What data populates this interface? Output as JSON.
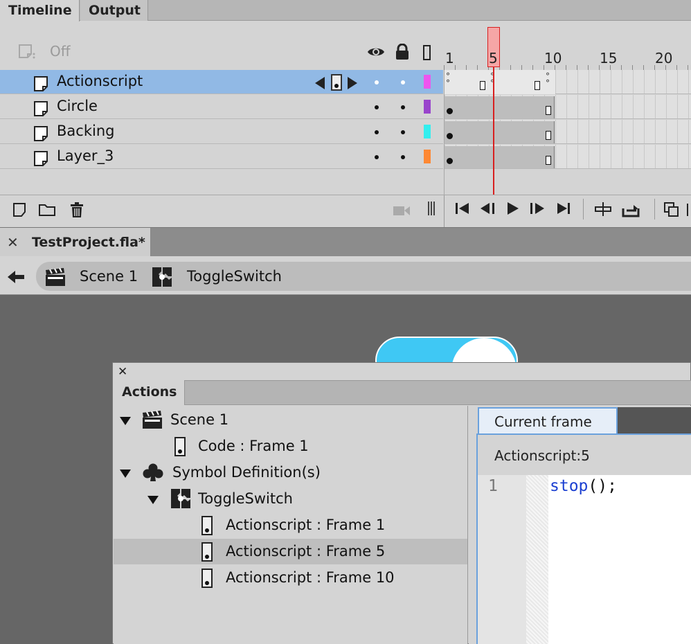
{
  "timeline_panel": {
    "tabs": [
      {
        "label": "Timeline"
      },
      {
        "label": "Output"
      }
    ],
    "off_label": "Off",
    "ruler": [
      "1",
      "5",
      "10",
      "15",
      "20"
    ],
    "layers": [
      {
        "name": "Actionscript",
        "color": "#ee55ee",
        "selected": true
      },
      {
        "name": "Circle",
        "color": "#9944cc",
        "selected": false
      },
      {
        "name": "Backing",
        "color": "#33eeee",
        "selected": false
      },
      {
        "name": "Layer_3",
        "color": "#ff8833",
        "selected": false
      }
    ],
    "current_frame": 5
  },
  "document": {
    "tab_title": "TestProject.fla*",
    "breadcrumb": [
      {
        "label": "Scene 1",
        "icon": "clapperboard-icon"
      },
      {
        "label": "ToggleSwitch",
        "icon": "movieclip-icon"
      }
    ]
  },
  "actions_panel": {
    "tab": "Actions",
    "tree": [
      {
        "label": "Scene 1",
        "icon": "clapperboard-icon"
      },
      {
        "label": "Code : Frame 1",
        "icon": "frame-script-icon"
      },
      {
        "label": "Symbol Definition(s)",
        "icon": "club-icon"
      },
      {
        "label": "ToggleSwitch",
        "icon": "movieclip-icon"
      },
      {
        "label": "Actionscript : Frame 1",
        "icon": "frame-script-icon"
      },
      {
        "label": "Actionscript : Frame 5",
        "icon": "frame-script-icon",
        "selected": true
      },
      {
        "label": "Actionscript : Frame 10",
        "icon": "frame-script-icon"
      }
    ],
    "code_tab": "Current frame",
    "location": "Actionscript:5",
    "code": {
      "line_number": "1",
      "keyword": "stop",
      "rest": "();"
    }
  },
  "stage": {
    "accent": "#3fc8f4"
  }
}
